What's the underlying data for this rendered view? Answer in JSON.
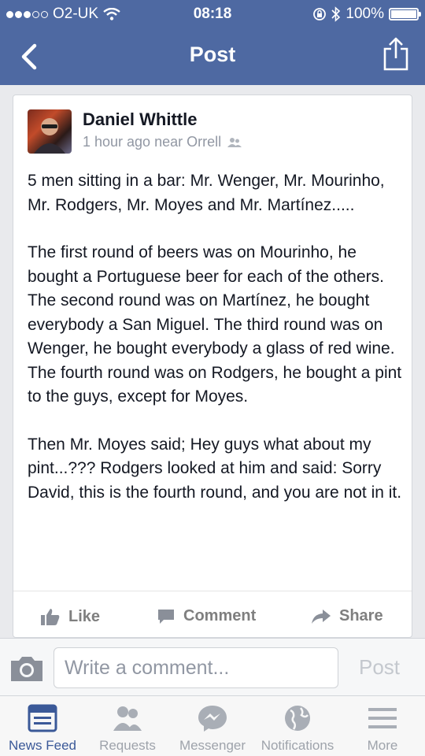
{
  "status_bar": {
    "carrier": "O2-UK",
    "time": "08:18",
    "battery": "100%",
    "battery_level": 1.0
  },
  "nav": {
    "title": "Post",
    "back_icon": "chevron-left-icon",
    "share_icon": "share-icon"
  },
  "post": {
    "author": "Daniel Whittle",
    "meta": "1 hour ago near Orrell",
    "paragraphs": [
      "5 men sitting in a bar: Mr. Wenger, Mr. Mourinho, Mr. Rodgers, Mr. Moyes and Mr. Martínez.....",
      "The first round of beers was on Mourinho, he bought a Portuguese beer for each of the others. The second round was on Martínez, he bought everybody a San Miguel. The third round was on Wenger, he bought everybody a glass of red wine. The fourth round was on Rodgers, he bought a pint to the guys, except for Moyes.",
      "Then Mr. Moyes said; Hey guys what about my pint...??? Rodgers looked at him and said: Sorry David, this is the fourth round, and you are not in it."
    ],
    "actions": {
      "like": "Like",
      "comment": "Comment",
      "share": "Share"
    }
  },
  "comment_bar": {
    "placeholder": "Write a comment...",
    "post_label": "Post"
  },
  "tabs": [
    {
      "label": "News Feed",
      "icon": "news-feed-icon",
      "active": true
    },
    {
      "label": "Requests",
      "icon": "friend-requests-icon",
      "active": false
    },
    {
      "label": "Messenger",
      "icon": "messenger-icon",
      "active": false
    },
    {
      "label": "Notifications",
      "icon": "globe-icon",
      "active": false
    },
    {
      "label": "More",
      "icon": "menu-icon",
      "active": false
    }
  ],
  "colors": {
    "brand": "#4e69a2",
    "active_tab": "#3b5998",
    "inactive": "#9ea3ab"
  }
}
